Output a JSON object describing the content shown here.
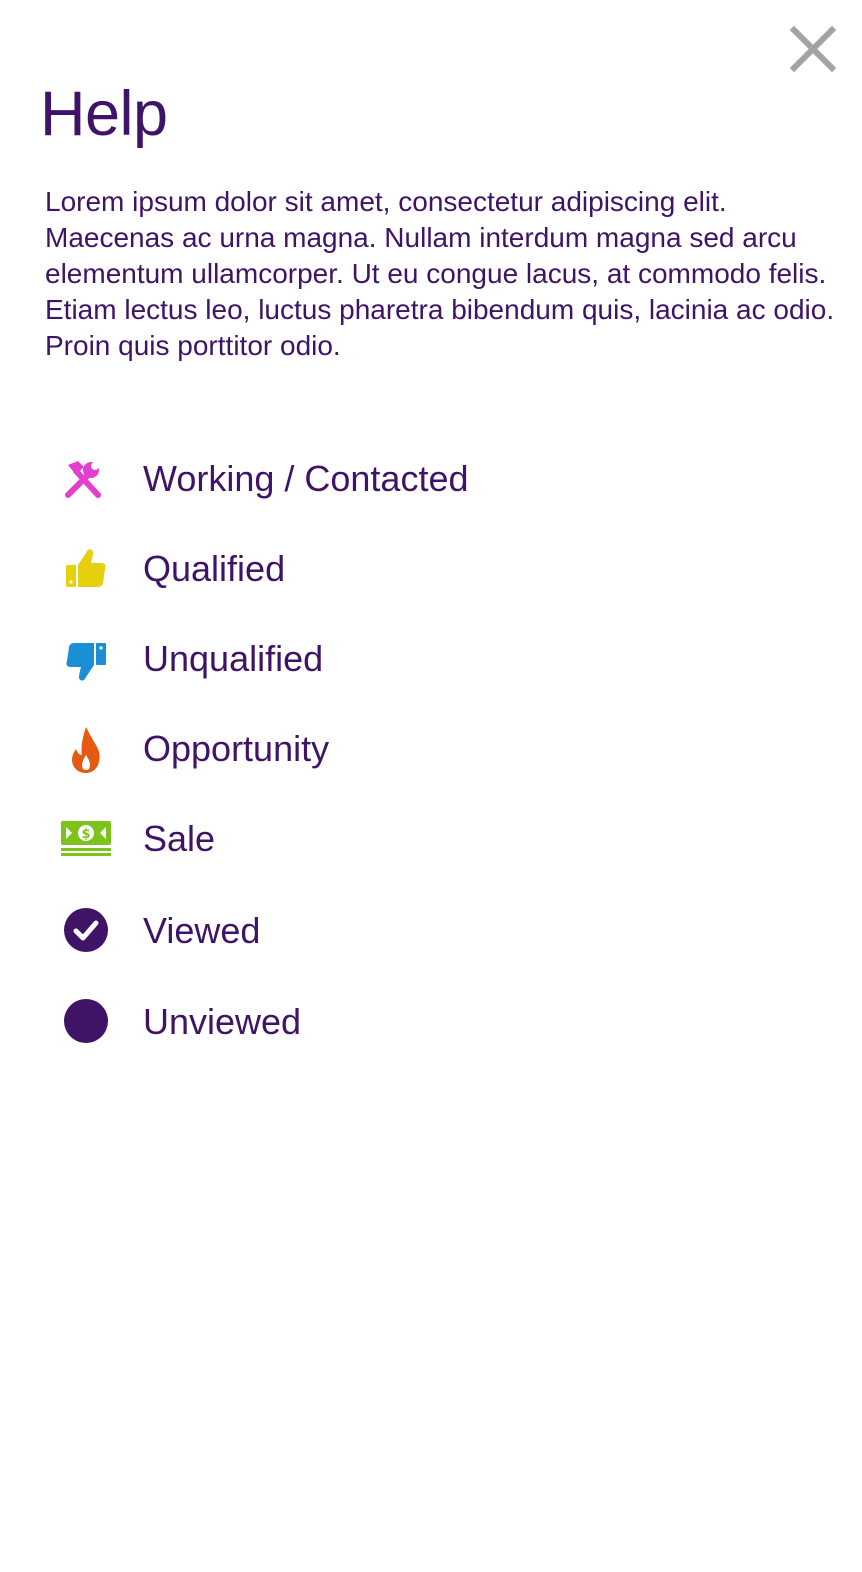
{
  "close": {
    "icon": "close-icon",
    "color": "#a3a3a3"
  },
  "title": "Help",
  "description": "Lorem ipsum dolor sit amet, consectetur adipiscing elit. Maecenas ac urna magna. Nullam interdum magna sed arcu elementum ullamcorper. Ut eu congue lacus, at commodo felis. Etiam lectus leo, luctus pharetra bibendum quis, lacinia ac odio. Proin quis porttitor odio.",
  "legend": [
    {
      "label": "Working / Contacted",
      "icon": "tools-icon",
      "color": "#e23fcf"
    },
    {
      "label": "Qualified",
      "icon": "thumbs-up-icon",
      "color": "#e6cf0c"
    },
    {
      "label": "Unqualified",
      "icon": "thumbs-down-icon",
      "color": "#1b8fd6"
    },
    {
      "label": "Opportunity",
      "icon": "flame-icon",
      "color": "#e55a12"
    },
    {
      "label": "Sale",
      "icon": "money-icon",
      "color": "#7dc31b"
    },
    {
      "label": "Viewed",
      "icon": "check-circle-icon",
      "color": "#3f1466"
    },
    {
      "label": "Unviewed",
      "icon": "circle-icon",
      "color": "#3f1466"
    }
  ],
  "colors": {
    "text": "#3f1466",
    "background": "#ffffff"
  }
}
